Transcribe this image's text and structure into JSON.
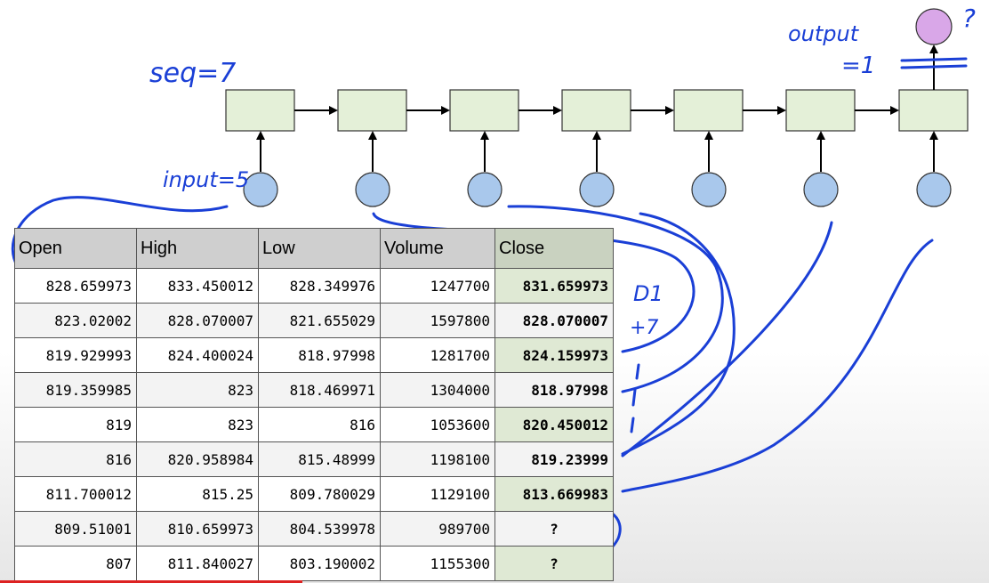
{
  "diagram": {
    "annotations": {
      "seq": "seq=7",
      "input": "input=5",
      "output_line1": "output",
      "output_line2": "=1",
      "question_top": "?",
      "d1": "D1",
      "plus7": "+7"
    },
    "cells_count": 7,
    "output_node_label": ""
  },
  "table": {
    "headers": [
      "Open",
      "High",
      "Low",
      "Volume",
      "Close"
    ],
    "rows": [
      [
        "828.659973",
        "833.450012",
        "828.349976",
        "1247700",
        "831.659973"
      ],
      [
        "823.02002",
        "828.070007",
        "821.655029",
        "1597800",
        "828.070007"
      ],
      [
        "819.929993",
        "824.400024",
        "818.97998",
        "1281700",
        "824.159973"
      ],
      [
        "819.359985",
        "823",
        "818.469971",
        "1304000",
        "818.97998"
      ],
      [
        "819",
        "823",
        "816",
        "1053600",
        "820.450012"
      ],
      [
        "816",
        "820.958984",
        "815.48999",
        "1198100",
        "819.23999"
      ],
      [
        "811.700012",
        "815.25",
        "809.780029",
        "1129100",
        "813.669983"
      ],
      [
        "809.51001",
        "810.659973",
        "804.539978",
        "989700",
        "?"
      ],
      [
        "807",
        "811.840027",
        "803.190002",
        "1155300",
        "?"
      ]
    ]
  },
  "colors": {
    "ink": "#1a3fd6",
    "cell_fill": "#e4f0d8",
    "input_fill": "#a9c8ec",
    "output_fill": "#d9a7e8",
    "header_bg": "#cfcfcf",
    "close_bg": "#dfe9d4"
  }
}
